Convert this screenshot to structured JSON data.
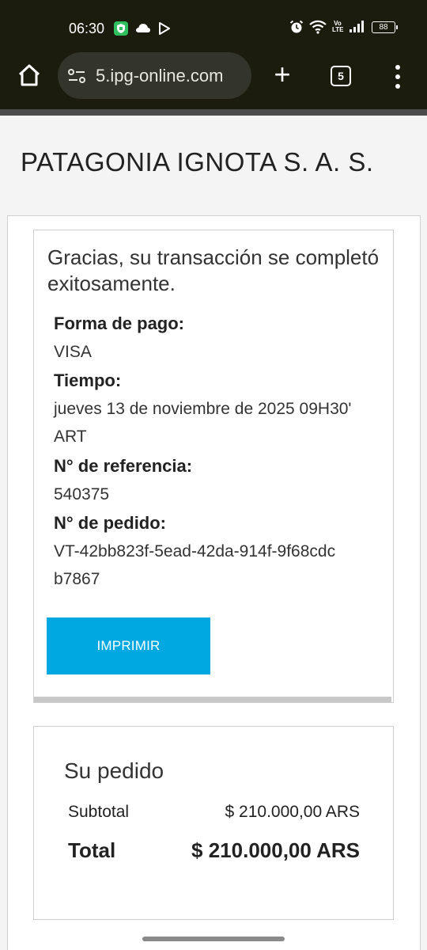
{
  "status_bar": {
    "time": "06:30",
    "battery": "88",
    "left_icons": [
      "shield-app-icon",
      "cloud-icon",
      "play-store-icon"
    ],
    "right_icons": [
      "alarm-icon",
      "wifi-icon",
      "volte-icon",
      "signal-icon",
      "battery-icon"
    ],
    "volte_text": "Vo LTE"
  },
  "browser": {
    "url": "5.ipg-online.com",
    "tab_count": "5",
    "new_tab_label": "+"
  },
  "page": {
    "title": "PATAGONIA IGNOTA S. A. S."
  },
  "result": {
    "message": "Gracias, su transacción se completó exitosamente.",
    "payment_label": "Forma de pago:",
    "payment_value": "VISA",
    "time_label": "Tiempo:",
    "time_value": "jueves 13 de noviembre de 2025 09H30' ART",
    "reference_label": "N° de referencia:",
    "reference_value": "540375",
    "order_label": "N° de pedido:",
    "order_value": "VT-42bb823f-5ead-42da-914f-9f68cdcb7867",
    "print_button": "IMPRIMIR"
  },
  "order": {
    "title": "Su pedido",
    "subtotal_label": "Subtotal",
    "subtotal_value": "$ 210.000,00 ARS",
    "total_label": "Total",
    "total_value": "$ 210.000,00 ARS"
  },
  "colors": {
    "accent": "#00a8e1",
    "chrome_bg": "#1b1b0e",
    "urlbar_bg": "#33342a"
  }
}
